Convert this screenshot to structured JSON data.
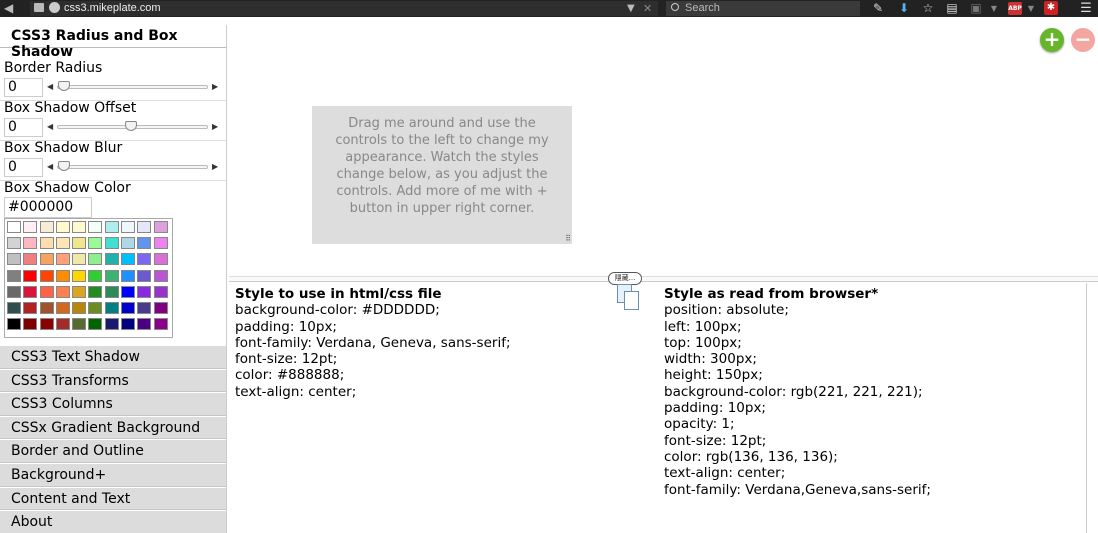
{
  "browser": {
    "url": "css3.mikeplate.com",
    "search_placeholder": "Search",
    "abp_label": "ABP"
  },
  "sidebar": {
    "title": "CSS3 Radius and Box Shadow",
    "controls": [
      {
        "label": "Border Radius",
        "value": "0",
        "slider_fraction": 0.0
      },
      {
        "label": "Box Shadow Offset",
        "value": "0",
        "slider_fraction": 0.5
      },
      {
        "label": "Box Shadow Blur",
        "value": "0",
        "slider_fraction": 0.0
      }
    ],
    "color": {
      "label": "Box Shadow Color",
      "value": "#000000",
      "swatches": [
        [
          "#ffffff",
          "#fff0f5",
          "#faebd7",
          "#fffacd",
          "#fffacd",
          "#f5fffa",
          "#afeeee",
          "#f0f8ff",
          "#e6e6fa",
          "#dda0dd"
        ],
        [
          "#d3d3d3",
          "#ffb6c1",
          "#ffdead",
          "#ffe4b5",
          "#f0e68c",
          "#98fb98",
          "#40e0d0",
          "#add8e6",
          "#6495ed",
          "#ee82ee"
        ],
        [
          "#c0c0c0",
          "#f08080",
          "#f4a460",
          "#ffa07a",
          "#eee8aa",
          "#90ee90",
          "#20b2aa",
          "#00bfff",
          "#7b68ee",
          "#da70d6"
        ],
        [
          "#808080",
          "#ff0000",
          "#ff4500",
          "#ff8c00",
          "#ffd700",
          "#32cd32",
          "#3cb371",
          "#1e90ff",
          "#6a5acd",
          "#ba55d3"
        ],
        [
          "#696969",
          "#dc143c",
          "#ff6347",
          "#ff7f50",
          "#daa520",
          "#228b22",
          "#2e8b57",
          "#0000ff",
          "#8a2be2",
          "#9932cc"
        ],
        [
          "#2f4f4f",
          "#b22222",
          "#a0522d",
          "#d2691e",
          "#b8860b",
          "#6b8e23",
          "#008080",
          "#0000cd",
          "#483d8b",
          "#800080"
        ],
        [
          "#000000",
          "#800000",
          "#8b0000",
          "#a52a2a",
          "#556b2f",
          "#006400",
          "#191970",
          "#000080",
          "#4b0082",
          "#8b008b"
        ]
      ]
    },
    "menu": [
      "CSS3 Text Shadow",
      "CSS3 Transforms",
      "CSS3 Columns",
      "CSSx Gradient Background",
      "Border and Outline",
      "Background+",
      "Content and Text",
      "About"
    ]
  },
  "main": {
    "add_label": "+",
    "remove_label": "−",
    "demo_text": "Drag me around and use the controls to the left to change my appearance. Watch the styles change below, as you adjust the controls. Add more of me with + button in upper right corner.",
    "hide_label": "隱藏...",
    "left_title": "Style to use in html/css file",
    "left_lines": [
      "background-color: #DDDDDD;",
      "padding: 10px;",
      "font-family: Verdana, Geneva, sans-serif;",
      "font-size: 12pt;",
      "color: #888888;",
      "text-align: center;"
    ],
    "right_title": "Style as read from browser*",
    "right_lines": [
      "position: absolute;",
      "left: 100px;",
      "top: 100px;",
      "width: 300px;",
      "height: 150px;",
      "background-color: rgb(221, 221, 221);",
      "padding: 10px;",
      "opacity: 1;",
      "font-size: 12pt;",
      "color: rgb(136, 136, 136);",
      "text-align: center;",
      "font-family: Verdana,Geneva,sans-serif;"
    ]
  }
}
